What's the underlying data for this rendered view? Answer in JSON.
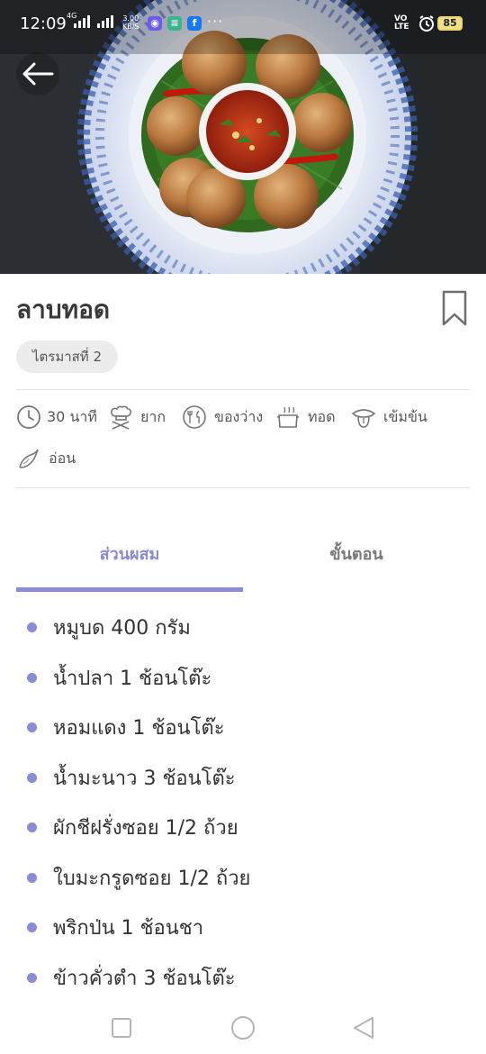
{
  "status_bar": {
    "time": "12:09",
    "network": "4G",
    "speed_value": "3.00",
    "speed_unit": "KB/S",
    "volte_top": "VO",
    "volte_bottom": "LTE",
    "battery": "85",
    "more": "···",
    "apps": [
      "messenger-app-icon",
      "notes-app-icon",
      "facebook-app-icon"
    ],
    "facebook_letter": "f"
  },
  "recipe": {
    "title": "ลาบทอด",
    "tag": "ไตรมาสที่ 2",
    "meta": [
      {
        "icon": "clock-icon",
        "label": "30 นาที"
      },
      {
        "icon": "chef-hat-icon",
        "label": "ยาก"
      },
      {
        "icon": "plate-utensils-icon",
        "label": "ของว่าง"
      },
      {
        "icon": "pot-icon",
        "label": "ทอด"
      },
      {
        "icon": "tongue-icon",
        "label": "เข้มข้น"
      },
      {
        "icon": "chili-icon",
        "label": "อ่อน"
      }
    ]
  },
  "tabs": {
    "ingredients": "ส่วนผสม",
    "steps": "ขั้นตอน",
    "active": "ingredients"
  },
  "ingredients": [
    "หมูบด 400 กรัม",
    "น้ำปลา 1 ช้อนโต๊ะ",
    "หอมแดง 1 ช้อนโต๊ะ",
    "น้ำมะนาว 3 ช้อนโต๊ะ",
    "ผักชีฝรั่งซอย 1/2 ถ้วย",
    "ใบมะกรูดซอย 1/2 ถ้วย",
    "พริกป่น 1 ช้อนชา",
    "ข้าวคั่วตำ 3 ช้อนโต๊ะ"
  ],
  "colors": {
    "accent": "#8b8cd8",
    "tab_inactive": "#7a7a7a",
    "chip_bg": "#ececec",
    "battery": "#efe08a"
  },
  "nav": [
    "recent-apps-button",
    "home-button",
    "back-nav-button"
  ]
}
